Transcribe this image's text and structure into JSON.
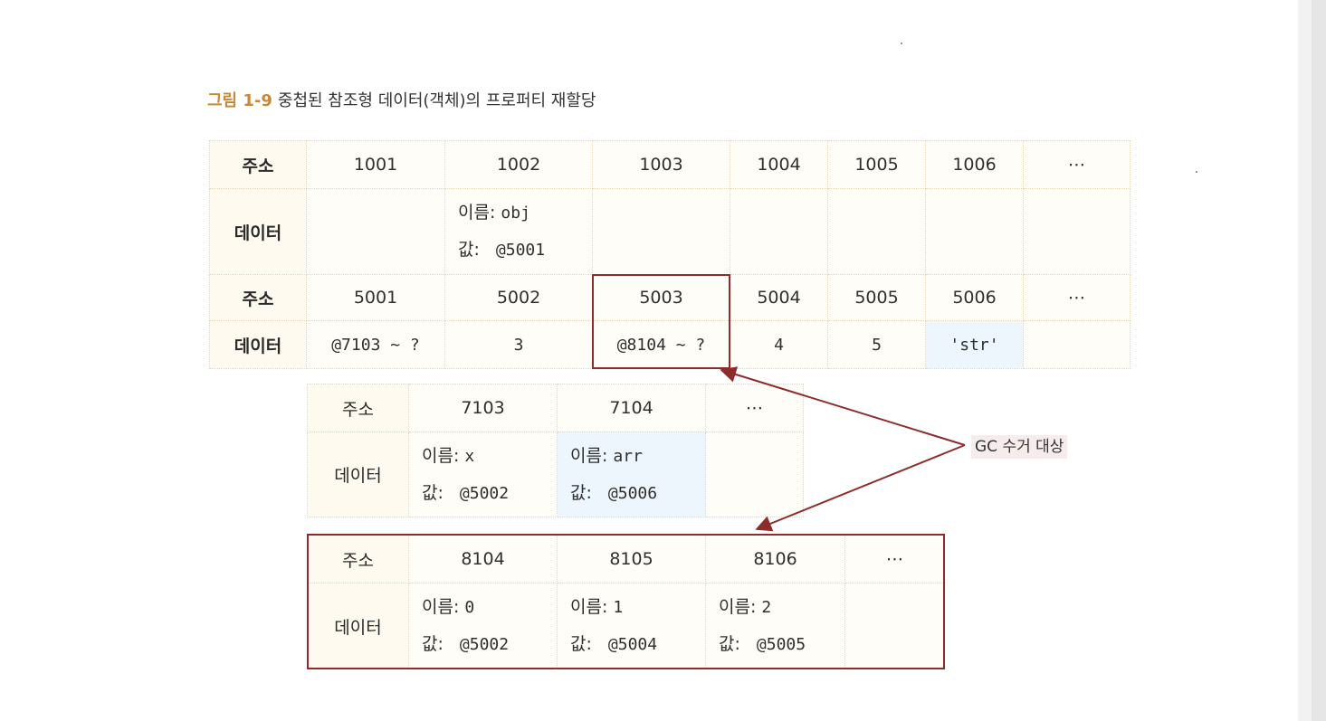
{
  "caption": {
    "number": "그림 1-9",
    "title": "중첩된 참조형 데이터(객체)의 프로퍼티 재할당"
  },
  "labels": {
    "addr": "주소",
    "data": "데이터",
    "name_prefix": "이름:",
    "value_prefix": "값:"
  },
  "table1": {
    "row1_addresses": [
      "1001",
      "1002",
      "1003",
      "1004",
      "1005",
      "1006",
      "⋯"
    ],
    "row1_data": {
      "name": "obj",
      "value": "@5001"
    },
    "row2_addresses": [
      "5001",
      "5002",
      "5003",
      "5004",
      "5005",
      "5006",
      "⋯"
    ],
    "row2_data": [
      "@7103 ~ ?",
      "3",
      "@8104 ~ ?",
      "4",
      "5",
      "'str'",
      ""
    ]
  },
  "table2": {
    "addresses": [
      "7103",
      "7104",
      "⋯"
    ],
    "items": [
      {
        "name": "x",
        "value": "@5002"
      },
      {
        "name": "arr",
        "value": "@5006"
      }
    ]
  },
  "table3": {
    "addresses": [
      "8104",
      "8105",
      "8106",
      "⋯"
    ],
    "items": [
      {
        "name": "0",
        "value": "@5002"
      },
      {
        "name": "1",
        "value": "@5004"
      },
      {
        "name": "2",
        "value": "@5005"
      }
    ]
  },
  "annotation": {
    "gc_label": "GC 수거 대상"
  },
  "colors": {
    "caption_accent": "#c7883b",
    "highlight_outline": "#8e2b2b",
    "highlight_fill": "#edf6fc"
  }
}
